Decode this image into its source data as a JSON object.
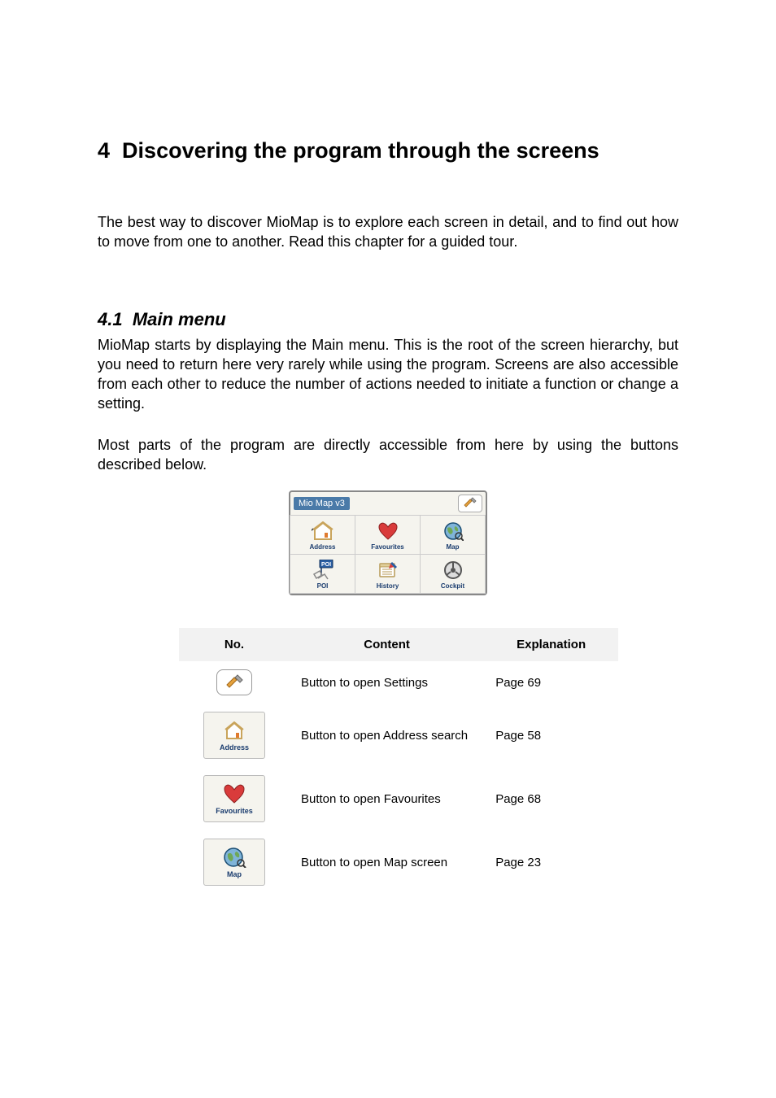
{
  "section": {
    "number": "4",
    "title": "Discovering the program through the screens",
    "intro": "The best way to discover MioMap is to explore each screen in detail, and to find out how to move from one to another. Read this chapter for a guided tour."
  },
  "subsection": {
    "number": "4.1",
    "title": "Main menu",
    "para1": "MioMap starts by displaying the Main menu. This is the root of the screen hierarchy, but you need to return here very rarely while using the program. Screens are also accessible from each other to reduce the number of actions needed to initiate a function or change a setting.",
    "para2": " Most parts of the program are directly accessible from here by using the buttons described below."
  },
  "menu_figure": {
    "title": "Mio Map v3",
    "cells": [
      {
        "label": "Address"
      },
      {
        "label": "Favourites"
      },
      {
        "label": "Map"
      },
      {
        "label": "POI"
      },
      {
        "label": "History"
      },
      {
        "label": "Cockpit"
      }
    ]
  },
  "table": {
    "headers": {
      "no": "No.",
      "content": "Content",
      "explanation": "Explanation"
    },
    "rows": [
      {
        "icon_label": "",
        "content": "Button to open Settings",
        "explanation": "Page 69"
      },
      {
        "icon_label": "Address",
        "content": "Button to open Address search",
        "explanation": "Page 58"
      },
      {
        "icon_label": "Favourites",
        "content": "Button to open Favourites",
        "explanation": "Page 68"
      },
      {
        "icon_label": "Map",
        "content": "Button to open Map screen",
        "explanation": "Page 23"
      }
    ]
  }
}
